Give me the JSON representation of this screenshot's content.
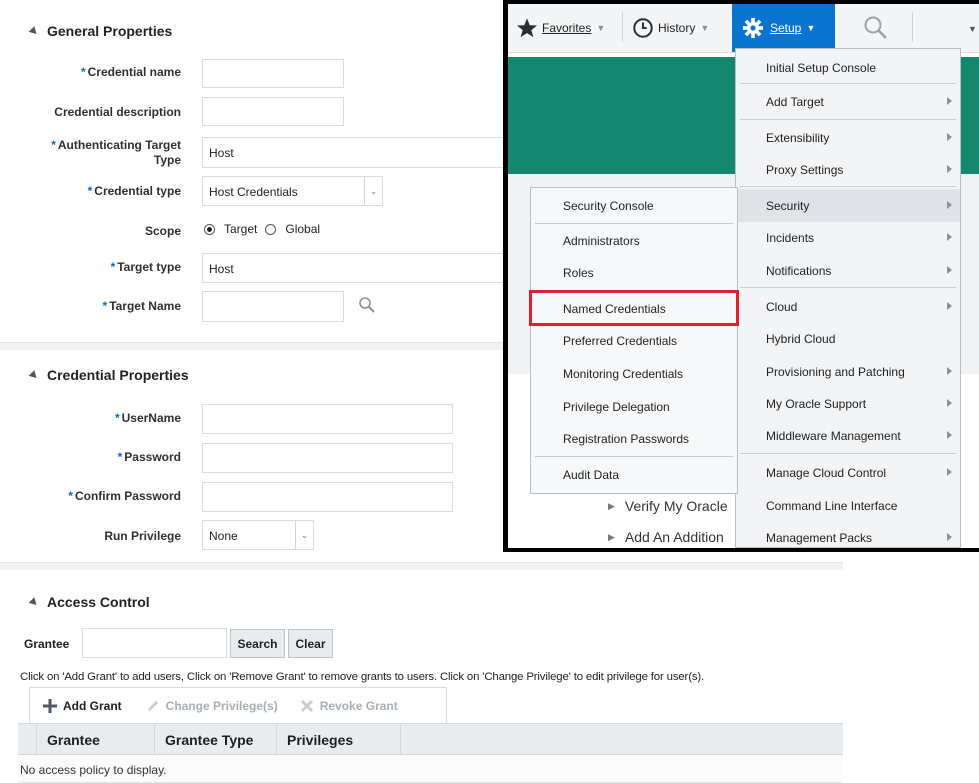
{
  "general": {
    "section_title": "General Properties",
    "credential_name_label": "Credential name",
    "credential_description_label": "Credential description",
    "auth_target_label_line1": "Authenticating Target",
    "auth_target_label_line2": "Type",
    "auth_target_value": "Host",
    "credential_type_label": "Credential type",
    "credential_type_value": "Host Credentials",
    "scope_label": "Scope",
    "scope_target": "Target",
    "scope_global": "Global",
    "target_type_label": "Target type",
    "target_type_value": "Host",
    "target_name_label": "Target Name"
  },
  "credential_props": {
    "section_title": "Credential Properties",
    "username_label": "UserName",
    "password_label": "Password",
    "confirm_password_label": "Confirm Password",
    "run_privilege_label": "Run Privilege",
    "run_privilege_value": "None"
  },
  "access": {
    "section_title": "Access Control",
    "grantee_label": "Grantee",
    "search_button": "Search",
    "clear_button": "Clear",
    "help_text": "Click on 'Add Grant' to add users, Click on 'Remove Grant' to remove grants to users. Click on 'Change Privilege' to edit privilege for user(s).",
    "add_grant": "Add Grant",
    "change_privilege": "Change Privilege(s)",
    "revoke_grant": "Revoke Grant",
    "columns": [
      "Grantee",
      "Grantee Type",
      "Privileges"
    ],
    "empty_text": "No access policy to display."
  },
  "menubar": {
    "favorites": "Favorites",
    "history": "History",
    "setup": "Setup"
  },
  "setup_menu": {
    "items": [
      "Initial Setup Console",
      "Add Target",
      "Extensibility",
      "Proxy Settings",
      "Security",
      "Incidents",
      "Notifications",
      "Cloud",
      "Hybrid Cloud",
      "Provisioning and Patching",
      "My Oracle Support",
      "Middleware Management",
      "Manage Cloud Control",
      "Command Line Interface",
      "Management Packs"
    ]
  },
  "security_submenu": {
    "items": [
      "Security Console",
      "Administrators",
      "Roles",
      "Named Credentials",
      "Preferred Credentials",
      "Monitoring Credentials",
      "Privilege Delegation",
      "Registration Passwords",
      "Audit Data"
    ]
  },
  "background_links": [
    "Verify My Oracle",
    "Add An Addition"
  ],
  "colors": {
    "green_band": "#16876f",
    "setup_blue": "#0a74d1",
    "highlight_red": "#e0202a"
  }
}
